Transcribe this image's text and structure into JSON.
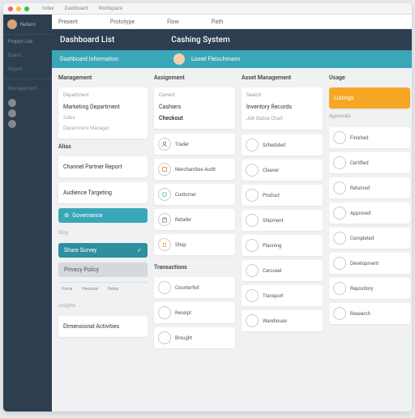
{
  "titlebar": {
    "tabs": [
      "Index",
      "Dashboard",
      "Workspace"
    ]
  },
  "sidebar": {
    "username": "Nelson",
    "items": [
      "Project List",
      "Board",
      "Report"
    ],
    "section2": "Management"
  },
  "toolbar": {
    "f1": "Present",
    "f2": "Prototype",
    "f3": "Flow",
    "f4": "Path"
  },
  "header": {
    "title": "Dashboard List",
    "title2": "Cashing System"
  },
  "subhead": {
    "l": "Dashboard Information",
    "r": "Lionel Fleischmann"
  },
  "col1": {
    "title": "Management",
    "card1": {
      "h": "Department",
      "item": "Marketing Department",
      "sub1": "Sales",
      "sub2": "Department Manager"
    },
    "alias_title": "Alias",
    "alias1": "Channel Partner Report",
    "alias2": "Audience Targeting",
    "btn1": "Governance",
    "blog": "Blog",
    "btn2": "Share Survey",
    "btn3": "Privacy Policy",
    "foot": [
      "Home",
      "Personal",
      "Notes"
    ],
    "insights": "Insights",
    "ins_item": "Dimensional Activities"
  },
  "col2": {
    "title": "Assignment",
    "h1": "Current",
    "cashiers": "Cashiers",
    "checkout": "Checkout",
    "tiles": [
      "Trader",
      "Merchandise Audit",
      "Customer",
      "Retailer",
      "Shop"
    ],
    "trans": "Transactions",
    "tiles2": [
      "Counterfeit",
      "Receipt",
      "Brought"
    ]
  },
  "col3": {
    "title": "Asset Management",
    "h1": "Search",
    "item1": "Inventory Records",
    "h2": "Job Status Chart",
    "tiles": [
      "Scheduled",
      "Cleaner",
      "Product",
      "Shipment",
      "Planning",
      "Carousel",
      "Transport",
      "Warehouse"
    ]
  },
  "col4": {
    "title": "Usage",
    "yellow": "Listings",
    "h1": "Approvals",
    "tiles": [
      "Finished",
      "Certified",
      "Returned",
      "Approved",
      "Completed",
      "Development",
      "Repository",
      "Research"
    ]
  },
  "colors": {
    "teal": "#3aa7b8",
    "navy": "#2c3e50",
    "amber": "#f5a623"
  }
}
